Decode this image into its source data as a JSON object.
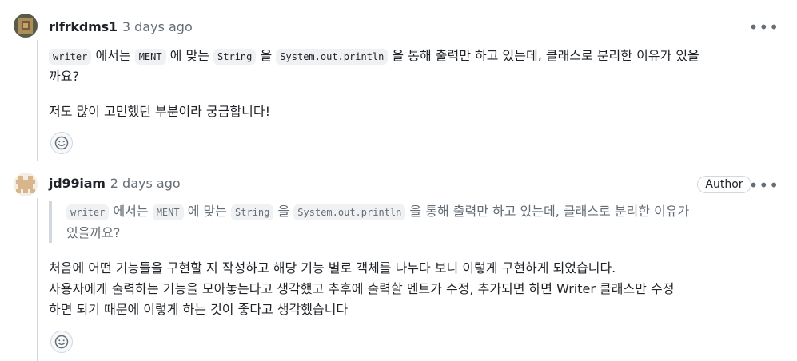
{
  "comments": [
    {
      "author": "rlfrkdms1",
      "time": "3 days ago",
      "line1": {
        "code1": "writer",
        "t1": " 에서는 ",
        "code2": "MENT",
        "t2": " 에 맞는 ",
        "code3": "String",
        "t3": " 을 ",
        "code4": "System.out.println",
        "t4": " 을 통해 출력만 하고 있는데, 클래스로 분리한 이유가 있을"
      },
      "line2": "까요?",
      "line3": "저도 많이 고민했던 부분이라 궁금합니다!",
      "more_label": "•••",
      "reaction_icon": "smiley-icon"
    },
    {
      "author": "jd99iam",
      "time": "2 days ago",
      "badge": "Author",
      "quote": {
        "code1": "writer",
        "t1": " 에서는 ",
        "code2": "MENT",
        "t2": " 에 맞는 ",
        "code3": "String",
        "t3": " 을 ",
        "code4": "System.out.println",
        "t4": " 을 통해 출력만 하고 있는데, 클래스로 분리한 이유가",
        "line2": "있을까요?"
      },
      "body": [
        "처음에 어떤 기능들을 구현할 지 작성하고 해당 기능 별로 객체를 나누다 보니 이렇게 구현하게 되었습니다.",
        "사용자에게 출력하는 기능을 모아놓는다고 생각했고 추후에 출력할 멘트가 수정, 추가되면 하면 Writer 클래스만 수정",
        "하면 되기 때문에 이렇게 하는 것이 좋다고 생각했습니다"
      ],
      "more_label": "•••",
      "reaction_icon": "smiley-icon"
    }
  ]
}
